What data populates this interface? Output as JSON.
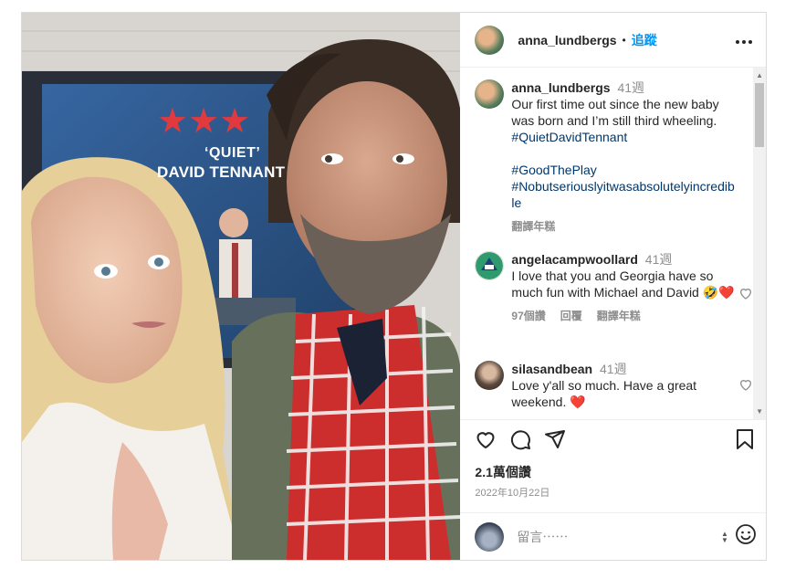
{
  "post": {
    "photo_text": {
      "poster_stars": "★★★",
      "poster_quote": "‘QUIET’",
      "poster_name": "DAVID TENNANT"
    },
    "author": {
      "username": "anna_lundbergs",
      "dot": "•",
      "follow_label": "追蹤",
      "more_icon": "more-horizontal-icon"
    },
    "caption": {
      "username": "anna_lundbergs",
      "time": "41週",
      "text": "Our first time out since the new baby was born and I’m still third wheeling.",
      "tag1": "#QuietDavidTennant",
      "tag2": "#GoodThePlay",
      "tag3": "#Nobutseriouslyitwasabsolutelyincredible",
      "translate": "翻譯年糕"
    },
    "comments": [
      {
        "username": "angelacampwoollard",
        "time": "41週",
        "text": "I love that you and Georgia have so much fun with Michael and David",
        "emoji": "🤣❤️",
        "likes": "97個讚",
        "reply": "回覆",
        "translate": "翻譯年糕"
      },
      {
        "username": "silasandbean",
        "time": "41週",
        "text": "Love y'all so much. Have a great weekend.",
        "emoji": "❤️"
      }
    ],
    "likes_count": "2.1萬個讚",
    "date": "2022年10月22日",
    "composer_placeholder": "留言⋯⋯",
    "colors": {
      "accent": "#0095f6",
      "hashtag": "#00376b",
      "muted": "#8e8e8e"
    }
  }
}
